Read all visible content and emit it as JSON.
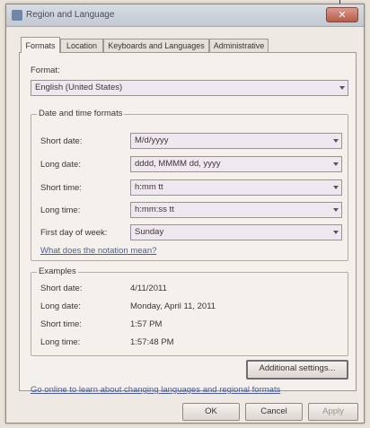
{
  "window": {
    "title": "Region and Language",
    "close_glyph": "✕"
  },
  "tabs": [
    {
      "label": "Formats",
      "active": true
    },
    {
      "label": "Location",
      "active": false
    },
    {
      "label": "Keyboards and Languages",
      "active": false
    },
    {
      "label": "Administrative",
      "active": false
    }
  ],
  "formats": {
    "format_label": "Format:",
    "format_value": "English (United States)"
  },
  "datetime": {
    "group_title": "Date and time formats",
    "short_date_label": "Short date:",
    "short_date_value": "M/d/yyyy",
    "long_date_label": "Long date:",
    "long_date_value": "dddd, MMMM dd, yyyy",
    "short_time_label": "Short time:",
    "short_time_value": "h:mm tt",
    "long_time_label": "Long time:",
    "long_time_value": "h:mm:ss tt",
    "first_day_label": "First day of week:",
    "first_day_value": "Sunday",
    "notation_link": "What does the notation mean?"
  },
  "examples": {
    "group_title": "Examples",
    "short_date_label": "Short date:",
    "short_date_value": "4/11/2011",
    "long_date_label": "Long date:",
    "long_date_value": "Monday, April 11, 2011",
    "short_time_label": "Short time:",
    "short_time_value": "1:57 PM",
    "long_time_label": "Long time:",
    "long_time_value": "1:57:48 PM"
  },
  "additional_settings_label": "Additional settings...",
  "online_link": "Go online to learn about changing languages and regional formats",
  "footer": {
    "ok_label": "OK",
    "cancel_label": "Cancel",
    "apply_label": "Apply"
  },
  "colors": {
    "combo_bg": "#f0e8f0",
    "link": "#4d5d93",
    "window_bg": "#eee9e3"
  },
  "icons": {
    "app": "region-globe-icon",
    "dropdown": "chevron-down-icon"
  }
}
